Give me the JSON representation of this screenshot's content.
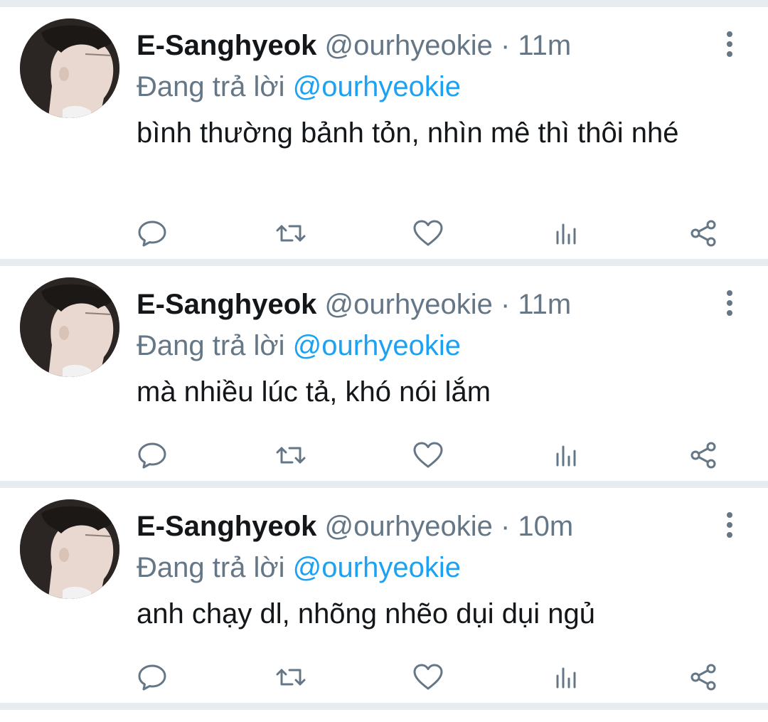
{
  "tweets": [
    {
      "name": "E-Sanghyeok",
      "handle": "@ourhyeokie",
      "separator": "·",
      "time": "11m",
      "replying_prefix": "Đang trả lời",
      "replying_to": "@ourhyeokie",
      "text": "bình thường bảnh tỏn, nhìn mê thì thôi nhé"
    },
    {
      "name": "E-Sanghyeok",
      "handle": "@ourhyeokie",
      "separator": "·",
      "time": "11m",
      "replying_prefix": "Đang trả lời",
      "replying_to": "@ourhyeokie",
      "text": "mà nhiều lúc tả, khó nói lắm"
    },
    {
      "name": "E-Sanghyeok",
      "handle": "@ourhyeokie",
      "separator": "·",
      "time": "10m",
      "replying_prefix": "Đang trả lời",
      "replying_to": "@ourhyeokie",
      "text": "anh chạy dl, nhõng nhẽo dụi dụi ngủ"
    }
  ],
  "icons": {
    "more": "more-vertical-icon",
    "reply": "reply-icon",
    "retweet": "retweet-icon",
    "like": "heart-icon",
    "stats": "analytics-icon",
    "share": "share-icon"
  },
  "colors": {
    "text": "#14171a",
    "secondary": "#657786",
    "mention": "#1da1f2",
    "divider": "#e6ecf0"
  }
}
